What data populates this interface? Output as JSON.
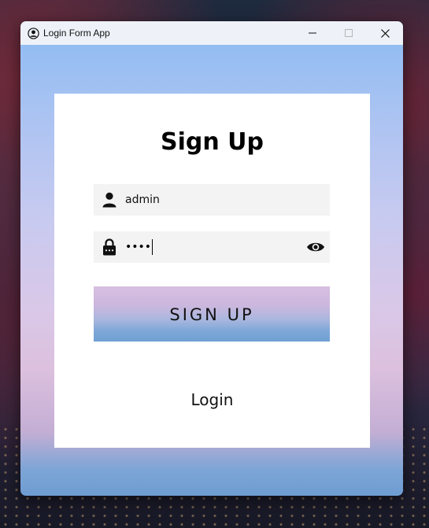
{
  "window": {
    "title": "Login Form App",
    "controls": {
      "minimize": "minimize-icon",
      "maximize": "maximize-icon",
      "close": "close-icon"
    }
  },
  "form": {
    "heading": "Sign Up",
    "username": {
      "value": "admin",
      "icon": "user-icon"
    },
    "password": {
      "masked_value": "••••",
      "icon": "lock-icon",
      "toggle_icon": "eye-icon"
    },
    "submit_label": "SIGN UP",
    "login_link": "Login"
  },
  "colors": {
    "titlebar": "#eef2f8",
    "card": "#ffffff",
    "field_bg": "#f3f3f3",
    "button_gradient_top": "#d7bfe0",
    "button_gradient_bottom": "#6fa0d4"
  }
}
